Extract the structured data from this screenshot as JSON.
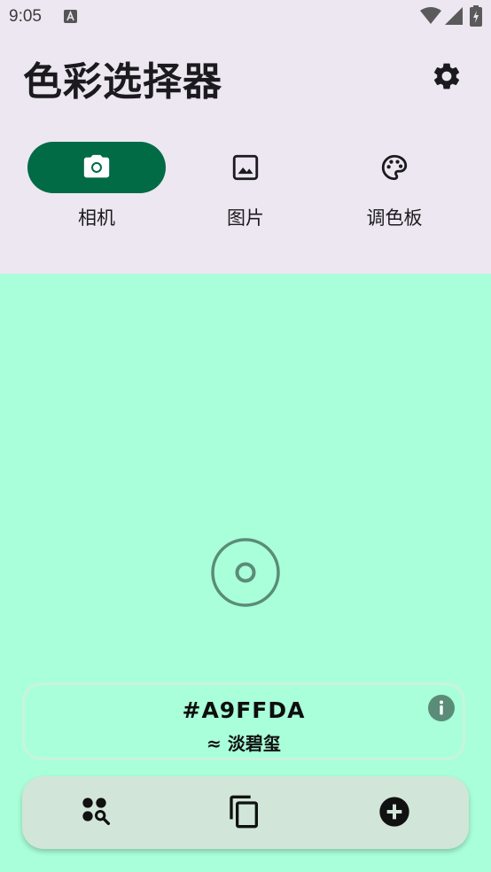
{
  "status_bar": {
    "time": "9:05",
    "icons": [
      "a-icon",
      "wifi-icon",
      "signal-icon",
      "battery-icon"
    ]
  },
  "app": {
    "title": "色彩选择器",
    "settings_icon": "gear-icon"
  },
  "tabs": [
    {
      "label": "相机",
      "icon": "camera-icon",
      "active": true
    },
    {
      "label": "图片",
      "icon": "image-icon",
      "active": false
    },
    {
      "label": "调色板",
      "icon": "palette-icon",
      "active": false
    }
  ],
  "color": {
    "hex": "#A9FFDA",
    "name": "≈ 淡碧玺"
  },
  "bottom_actions": [
    "search-colors-icon",
    "copy-icon",
    "add-circle-icon"
  ],
  "colors": {
    "background": "#A9FFDA",
    "header": "#ECE7F0",
    "accent": "#006B45",
    "bottom_bar": "#D1E6D8"
  }
}
